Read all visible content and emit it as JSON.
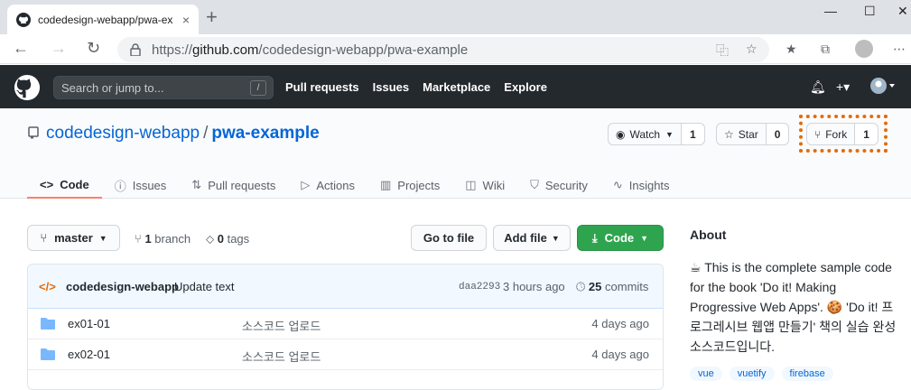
{
  "browser": {
    "tab_title": "codedesign-webapp/pwa-examp",
    "tab_close": "×",
    "new_tab": "+",
    "url_prefix": "https://",
    "url_host": "github.com",
    "url_path": "/codedesign-webapp/pwa-example",
    "window_minimize": "—",
    "window_maximize": "☐",
    "window_close": "✕"
  },
  "gh_header": {
    "search_placeholder": "Search or jump to...",
    "search_shortcut": "/",
    "nav": [
      "Pull requests",
      "Issues",
      "Marketplace",
      "Explore"
    ]
  },
  "repo": {
    "owner": "codedesign-webapp",
    "separator": "/",
    "name": "pwa-example",
    "watch_label": "Watch",
    "watch_count": "1",
    "star_label": "Star",
    "star_count": "0",
    "fork_label": "Fork",
    "fork_count": "1",
    "tabs": [
      {
        "label": "Code",
        "icon": "code-icon"
      },
      {
        "label": "Issues",
        "icon": "issue-icon"
      },
      {
        "label": "Pull requests",
        "icon": "pull-request-icon"
      },
      {
        "label": "Actions",
        "icon": "play-icon"
      },
      {
        "label": "Projects",
        "icon": "project-icon"
      },
      {
        "label": "Wiki",
        "icon": "book-icon"
      },
      {
        "label": "Security",
        "icon": "shield-icon"
      },
      {
        "label": "Insights",
        "icon": "graph-icon"
      }
    ]
  },
  "toolbar": {
    "branch": "master",
    "branch_count": "1",
    "branch_word": "branch",
    "tag_count": "0",
    "tag_word": "tags",
    "go_to_file": "Go to file",
    "add_file": "Add file",
    "code": "Code"
  },
  "commit": {
    "author": "codedesign-webapp",
    "message": "Update text",
    "sha": "daa2293",
    "time": "3 hours ago",
    "count": "25",
    "count_word": "commits"
  },
  "files": [
    {
      "name": "ex01-01",
      "message": "소스코드 업로드",
      "age": "4 days ago"
    },
    {
      "name": "ex02-01",
      "message": "소스코드 업로드",
      "age": "4 days ago"
    }
  ],
  "about": {
    "heading": "About",
    "description": "This is the complete sample code for the book 'Do it! Making Progressive Web Apps'. 🍪 'Do it! 프로그레시브 웹앱 만들기' 책의 실습 완성 소스코드입니다.",
    "topics": [
      "vue",
      "vuetify",
      "firebase"
    ]
  },
  "colors": {
    "header_bg": "#24292e",
    "link_blue": "#0366d6",
    "green_button": "#2ea44f",
    "highlight_orange": "#e36c0a",
    "active_tab_underline": "#f9826c"
  }
}
